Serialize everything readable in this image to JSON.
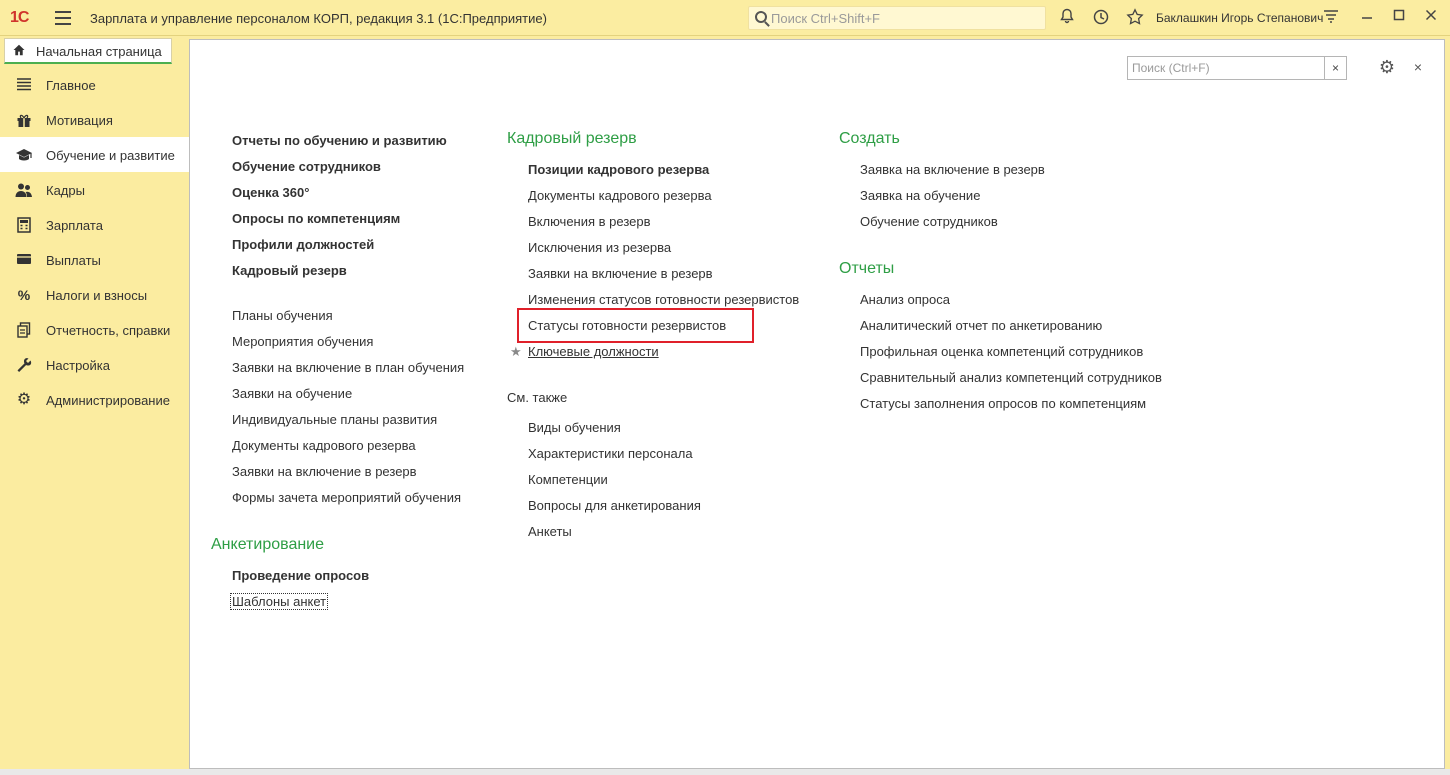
{
  "app": {
    "logo": "1С",
    "title": "Зарплата и управление персоналом КОРП, редакция 3.1  (1С:Предприятие)",
    "search_placeholder": "Поиск Ctrl+Shift+F",
    "user": "Баклашкин Игорь Степанович"
  },
  "tabs": {
    "home": "Начальная страница"
  },
  "sidebar": {
    "items": [
      {
        "label": "Главное",
        "icon": "menu-lines-icon"
      },
      {
        "label": "Мотивация",
        "icon": "gift-icon"
      },
      {
        "label": "Обучение и развитие",
        "icon": "graduation-cap-icon"
      },
      {
        "label": "Кадры",
        "icon": "people-icon"
      },
      {
        "label": "Зарплата",
        "icon": "calculator-icon"
      },
      {
        "label": "Выплаты",
        "icon": "wallet-icon"
      },
      {
        "label": "Налоги и взносы",
        "icon": "percent-icon"
      },
      {
        "label": "Отчетность, справки",
        "icon": "documents-icon"
      },
      {
        "label": "Настройка",
        "icon": "wrench-icon"
      },
      {
        "label": "Администрирование",
        "icon": "gear-icon"
      }
    ],
    "active_index": 2
  },
  "main": {
    "search_placeholder": "Поиск (Ctrl+F)",
    "clear_label": "×",
    "close_label": "×",
    "col1": {
      "bold_links": [
        "Отчеты по обучению и развитию",
        "Обучение сотрудников",
        "Оценка 360°",
        "Опросы по компетенциям",
        "Профили должностей",
        "Кадровый резерв"
      ],
      "links": [
        "Планы обучения",
        "Мероприятия обучения",
        "Заявки на включение в план обучения",
        "Заявки на обучение",
        "Индивидуальные планы развития",
        "Документы кадрового резерва",
        "Заявки на включение в резерв",
        "Формы зачета мероприятий обучения"
      ],
      "section_title": "Анкетирование",
      "section_links": [
        "Проведение опросов",
        "Шаблоны анкет"
      ]
    },
    "col2": {
      "title": "Кадровый резерв",
      "links": [
        "Позиции кадрового резерва",
        "Документы кадрового резерва",
        "Включения в резерв",
        "Исключения из резерва",
        "Заявки на включение в резерв",
        "Изменения статусов готовности резервистов",
        "Статусы готовности резервистов",
        "Ключевые должности"
      ],
      "see_also_title": "См. также",
      "see_also": [
        "Виды обучения",
        "Характеристики персонала",
        "Компетенции",
        "Вопросы для анкетирования",
        "Анкеты"
      ]
    },
    "col3": {
      "create_title": "Создать",
      "create_links": [
        "Заявка на включение в резерв",
        "Заявка на обучение",
        "Обучение сотрудников"
      ],
      "reports_title": "Отчеты",
      "reports_links": [
        "Анализ опроса",
        "Аналитический отчет по анкетированию",
        "Профильная оценка компетенций сотрудников",
        "Сравнительный анализ компетенций сотрудников",
        "Статусы заполнения опросов по компетенциям"
      ]
    }
  },
  "colors": {
    "accent_green": "#2e9e45",
    "highlight_red": "#e0202a",
    "panel_yellow": "#fbeca0"
  }
}
